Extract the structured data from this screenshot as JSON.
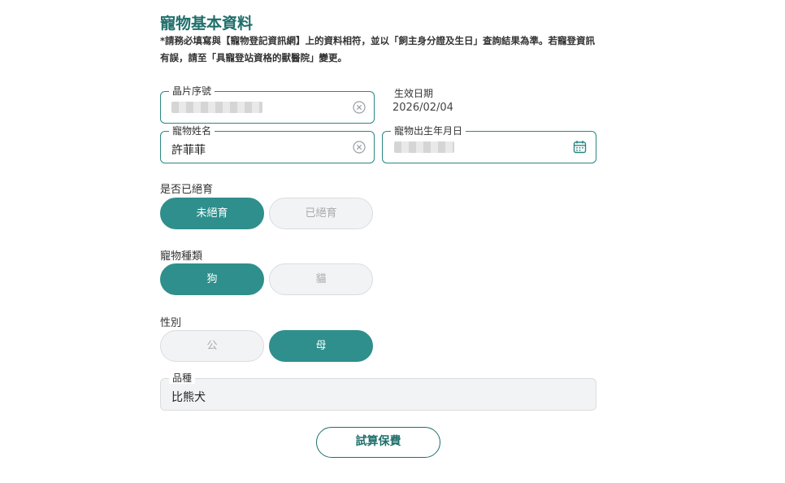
{
  "section": {
    "title": "寵物基本資料",
    "notice_line1": "*請務必填寫與【寵物登記資訊網】上的資料相符，並以「飼主身分證及生日」查詢結果為準。若寵登資訊",
    "notice_line2": "有誤，請至「具寵登站資格的獸醫院」變更。"
  },
  "chip": {
    "label": "晶片序號",
    "value": ""
  },
  "effective_date": {
    "label": "生效日期",
    "value": "2026/02/04"
  },
  "pet_name": {
    "label": "寵物姓名",
    "value": "許菲菲"
  },
  "pet_birthdate": {
    "label": "寵物出生年月日",
    "value": ""
  },
  "neutered": {
    "question": "是否已絕育",
    "options": [
      "未絕育",
      "已絕育"
    ],
    "selected": "未絕育"
  },
  "pet_type": {
    "question": "寵物種類",
    "options": [
      "狗",
      "貓"
    ],
    "selected": "狗"
  },
  "gender": {
    "question": "性別",
    "options": [
      "公",
      "母"
    ],
    "selected": "母"
  },
  "breed": {
    "label": "品種",
    "value": "比熊犬"
  },
  "submit": {
    "label": "試算保費"
  },
  "colors": {
    "primary": "#2f8f8c",
    "title": "#1f6f6c",
    "disabled_bg": "#f2f3f5"
  },
  "icons": {
    "clear": "clear-circle-icon",
    "calendar": "calendar-icon"
  }
}
